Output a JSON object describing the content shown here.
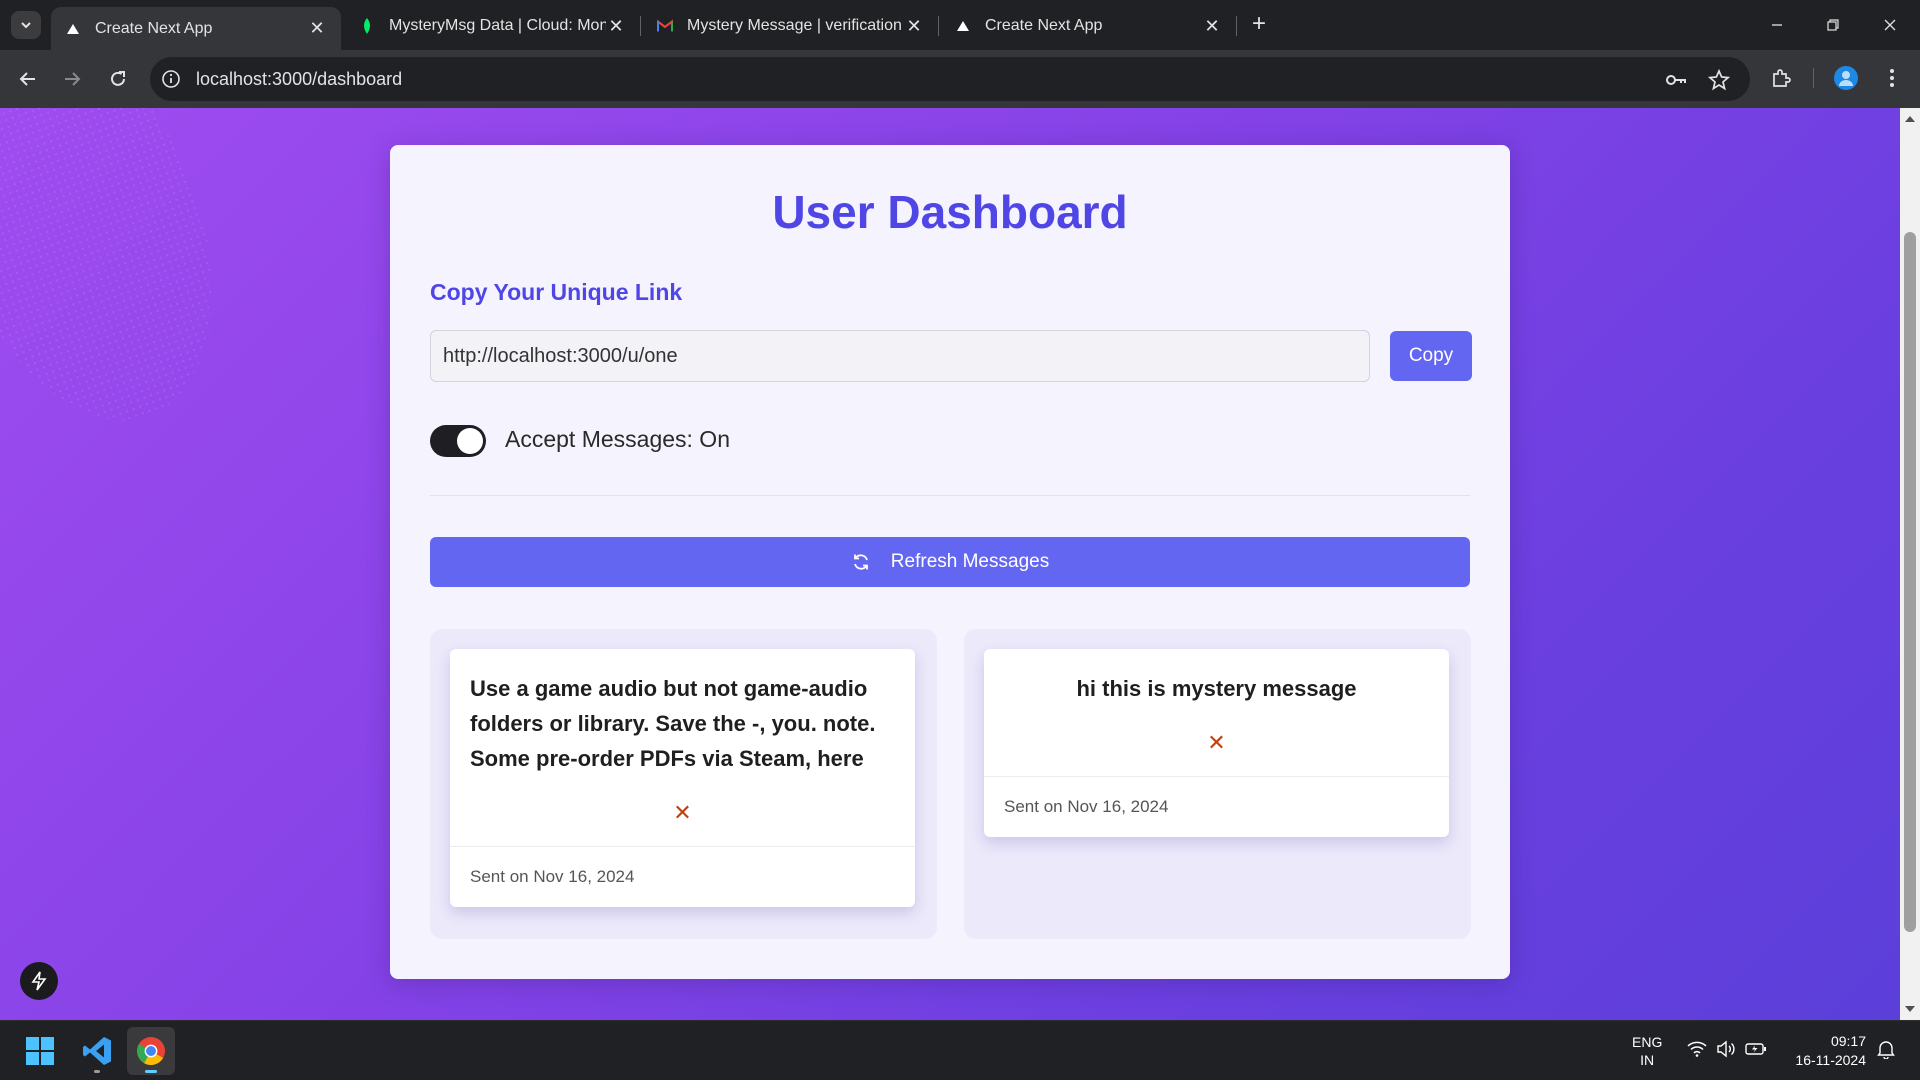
{
  "browser": {
    "tabs": [
      {
        "title": "Create Next App",
        "active": true
      },
      {
        "title": "MysteryMsg Data | Cloud: Mon",
        "active": false
      },
      {
        "title": "Mystery Message | verification c",
        "active": false
      },
      {
        "title": "Create Next App",
        "active": false
      }
    ],
    "url": "localhost:3000/dashboard"
  },
  "dashboard": {
    "title": "User Dashboard",
    "link_section_label": "Copy Your Unique Link",
    "unique_link": "http://localhost:3000/u/one",
    "copy_label": "Copy",
    "accept_messages_label": "Accept Messages: On",
    "accept_messages_on": true,
    "refresh_label": "Refresh Messages",
    "messages": [
      {
        "content": "Use a game audio but not game-audio folders or library. Save the -, you. note. Some pre-order PDFs via Steam, here",
        "delete_glyph": "✕",
        "sent": "Sent on Nov 16, 2024"
      },
      {
        "content": "hi this is mystery message",
        "delete_glyph": "✕",
        "sent": "Sent on Nov 16, 2024"
      }
    ]
  },
  "taskbar": {
    "lang_line1": "ENG",
    "lang_line2": "IN",
    "time": "09:17",
    "date": "16-11-2024"
  },
  "colors": {
    "accent": "#4f46e5",
    "button": "#6366f1",
    "delete": "#c2410c",
    "gradient_start": "#9f4cf0",
    "gradient_end": "#5b3fd9"
  }
}
